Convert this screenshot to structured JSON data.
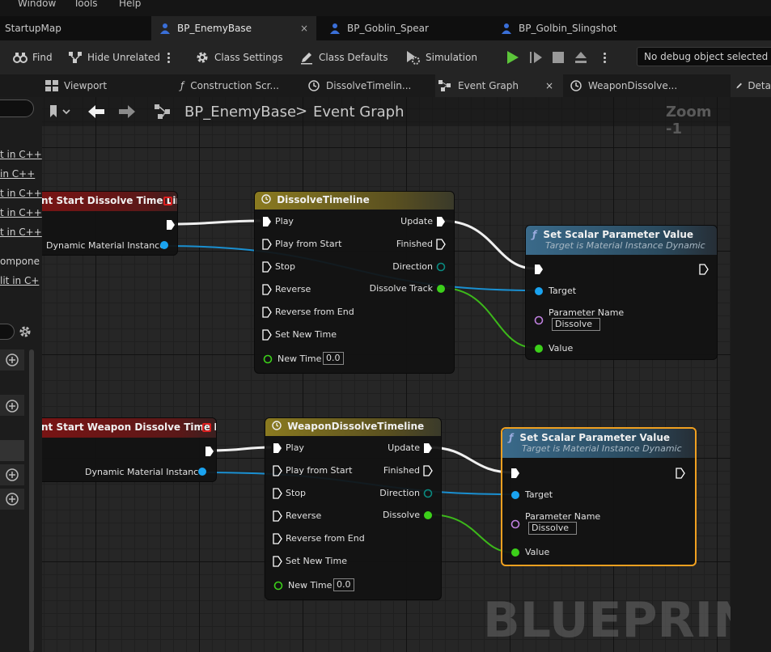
{
  "menu": [
    "Window",
    "Tools",
    "Help"
  ],
  "doc_tabs": [
    {
      "label": "StartupMap"
    },
    {
      "label": "BP_EnemyBase",
      "close": "×"
    },
    {
      "label": "BP_Goblin_Spear"
    },
    {
      "label": "BP_Golbin_Slingshot"
    }
  ],
  "toolbar": {
    "find": "Find",
    "hide_unrelated": "Hide Unrelated",
    "class_settings": "Class Settings",
    "class_defaults": "Class Defaults",
    "simulation": "Simulation",
    "debug_object": "No debug object selected"
  },
  "sub_tabs": [
    {
      "label": "Viewport"
    },
    {
      "label": "Construction Scr..."
    },
    {
      "label": "DissolveTimelin..."
    },
    {
      "label": "Event Graph",
      "close": "×"
    },
    {
      "label": "WeaponDissolve..."
    },
    {
      "label": "Deta"
    }
  ],
  "graph_nav": {
    "blueprint": "BP_EnemyBase",
    "separator": ">",
    "graph": "Event Graph",
    "zoom": "Zoom -1"
  },
  "left_panel": {
    "items": [
      "t in C++",
      "in C++",
      "t in C++",
      "t in C++",
      "t in C++",
      "ompone",
      "lit in C+"
    ]
  },
  "nodes": {
    "event1": {
      "title": "nt Start Dissolve Time Line",
      "pin": "Dynamic Material Instance"
    },
    "timeline1": {
      "title": "DissolveTimeline",
      "inputs": [
        "Play",
        "Play from Start",
        "Stop",
        "Reverse",
        "Reverse from End",
        "Set New Time"
      ],
      "new_time_label": "New Time",
      "new_time_value": "0.0",
      "outputs": [
        "Update",
        "Finished",
        "Direction",
        "Dissolve Track"
      ]
    },
    "setscalar1": {
      "title": "Set Scalar Parameter Value",
      "subtitle": "Target is Material Instance Dynamic",
      "target": "Target",
      "param_label": "Parameter Name",
      "param_value": "Dissolve",
      "value": "Value"
    },
    "event2": {
      "title": "nt Start Weapon Dissolve Time Line",
      "pin": "Dynamic Material Instance"
    },
    "timeline2": {
      "title": "WeaponDissolveTimeline",
      "inputs": [
        "Play",
        "Play from Start",
        "Stop",
        "Reverse",
        "Reverse from End",
        "Set New Time"
      ],
      "new_time_label": "New Time",
      "new_time_value": "0.0",
      "outputs": [
        "Update",
        "Finished",
        "Direction",
        "Dissolve"
      ]
    },
    "setscalar2": {
      "title": "Set Scalar Parameter Value",
      "subtitle": "Target is Material Instance Dynamic",
      "target": "Target",
      "param_label": "Parameter Name",
      "param_value": "Dissolve",
      "value": "Value"
    }
  },
  "watermark": "BLUEPRINT",
  "colors": {
    "exec": "#ffffff",
    "object_pin": "#1aa3f0",
    "float_pin": "#3ccf1a",
    "name_pin": "#c080e0",
    "event_header": "#8a1a1a",
    "timeline_header": "#7a6a20",
    "function_header": "#2a5a7a",
    "selection": "#f0a020"
  }
}
